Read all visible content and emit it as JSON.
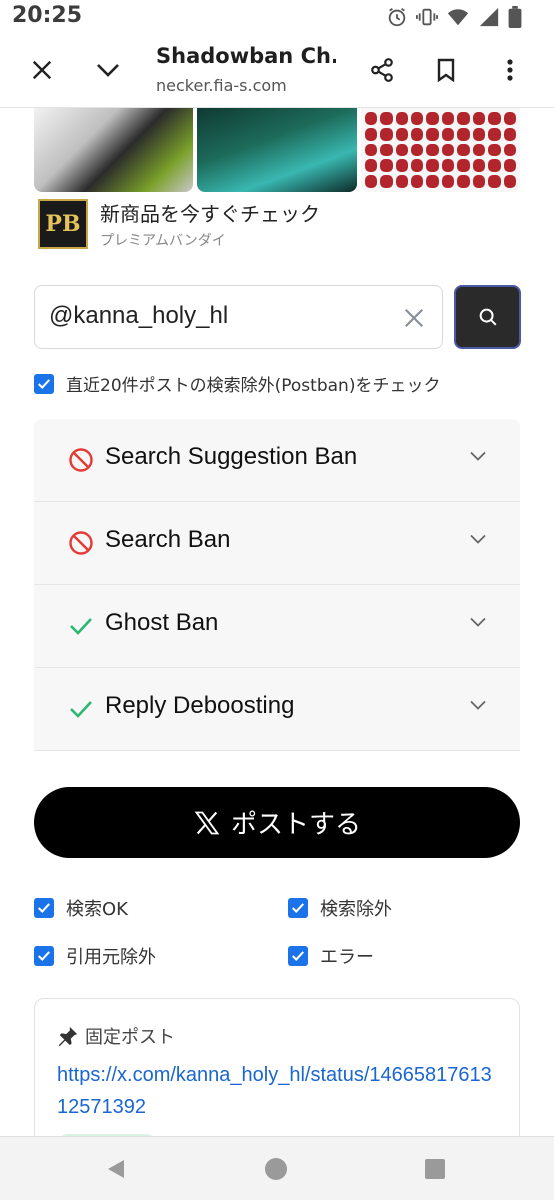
{
  "status": {
    "time": "20:25",
    "icons": [
      "alarm-icon",
      "vibrate-icon",
      "wifi-icon",
      "signal-icon",
      "battery-icon"
    ]
  },
  "browser": {
    "title": "Shadowban Ch...",
    "url": "necker.fia-s.com",
    "icons": [
      "close-icon",
      "chevron-down-icon",
      "share-icon",
      "bookmark-icon",
      "more-vert-icon"
    ]
  },
  "ad": {
    "logo_text": "PB",
    "title": "新商品を今すぐチェック",
    "subtitle": "プレミアムバンダイ"
  },
  "search": {
    "value": "@kanna_holy_hl"
  },
  "postban_check": {
    "checked": true,
    "label": "直近20件ポストの検索除外(Postban)をチェック"
  },
  "results": [
    {
      "label": "Search Suggestion Ban",
      "status": "banned",
      "icon": "ban-icon"
    },
    {
      "label": "Search Ban",
      "status": "banned",
      "icon": "ban-icon"
    },
    {
      "label": "Ghost Ban",
      "status": "ok",
      "icon": "check-icon"
    },
    {
      "label": "Reply Deboosting",
      "status": "ok",
      "icon": "check-icon"
    }
  ],
  "post_button": {
    "label": "ポストする"
  },
  "filters": [
    {
      "label": "検索OK",
      "checked": true
    },
    {
      "label": "検索除外",
      "checked": true
    },
    {
      "label": "引用元除外",
      "checked": true
    },
    {
      "label": "エラー",
      "checked": true
    }
  ],
  "pinned": {
    "title": "固定ポスト",
    "link": "https://x.com/kanna_holy_hl/status/1466581761312571392"
  },
  "colors": {
    "ban": "#e53935",
    "ok": "#2bb673",
    "checkbox": "#1a73e8",
    "link": "#1a66d2",
    "post_button": "#000000"
  }
}
